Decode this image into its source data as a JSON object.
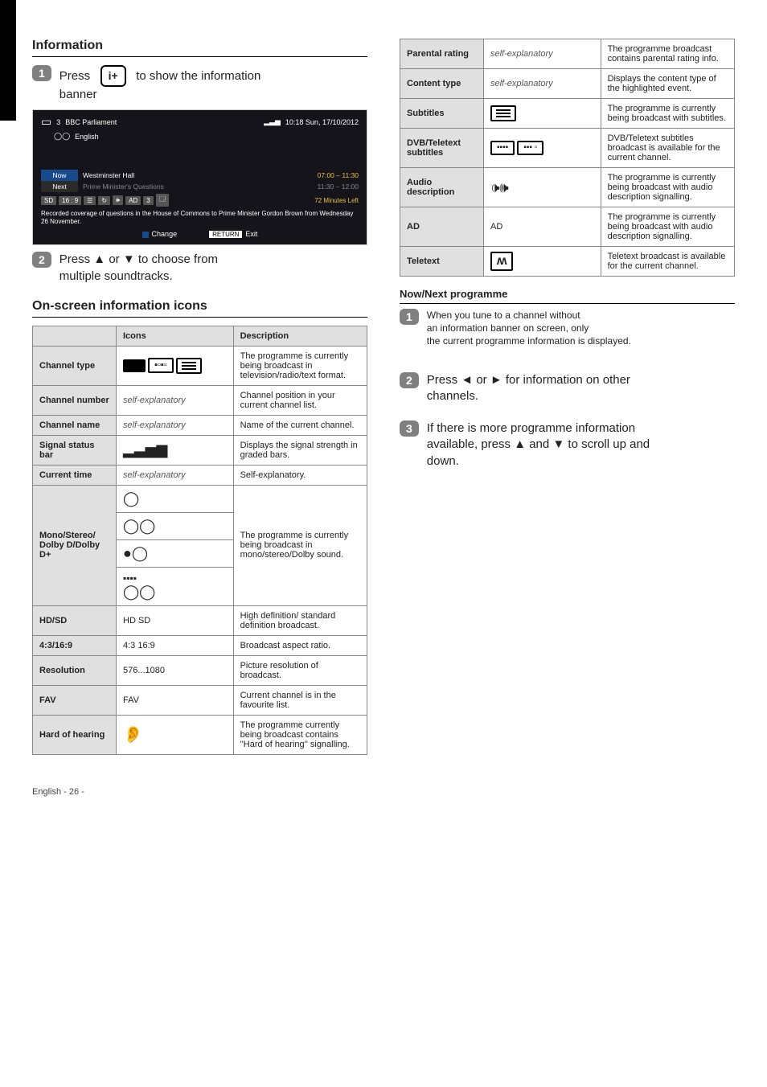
{
  "footer": "English - 26 -",
  "left": {
    "banner": {
      "chnum": "3",
      "chname": "BBC Parliament",
      "clock": "10:18  Sun, 17/10/2012",
      "lang_row_label": "English",
      "now_label": "Now",
      "now_prog": "Westminster Hall",
      "now_time": "07:00 – 11:30",
      "next_label": "Next",
      "next_prog": "Prime Minister's Questions",
      "next_time": "11:30 – 12:00",
      "chips": {
        "sd": "SD",
        "aspect": "16 : 9",
        "ad": "AD",
        "num3": "3",
        "rem": "72 Minutes Left"
      },
      "desc": "Recorded coverage of questions in the House of Commons to Prime Minister Gordon Brown from Wednesday 26 November.",
      "foot_change": "Change",
      "foot_exit": "Exit",
      "foot_return": "RETURN"
    },
    "h_info": "Information",
    "step1": "Press         to show the information",
    "step1_tail": "banner",
    "step2": "Press ▲ or ▼ to choose from",
    "step2_tail": "multiple soundtracks.",
    "h_icons": "On-screen information icons",
    "table_head": {
      "icons": "Icons",
      "desc": "Description"
    },
    "rows": [
      {
        "label": "Channel type",
        "desc": "The programme is currently being broadcast in television/radio/text format."
      },
      {
        "label": "Channel number",
        "icon_text": "self-explanatory",
        "desc": "Channel position in your current channel list."
      },
      {
        "label": "Channel name",
        "icon_text": "self-explanatory",
        "desc": "Name of the current channel."
      },
      {
        "label": "Signal status bar",
        "desc": "Displays the signal strength in graded bars."
      },
      {
        "label": "Current time",
        "icon_text": "self-explanatory",
        "desc": "Self-explanatory."
      },
      {
        "label": "Mono/Stereo/ Dolby D/Dolby D+",
        "desc": "The programme is currently being broadcast in mono/stereo/Dolby sound."
      },
      {
        "label": "HD/SD",
        "icon_text": "HD    SD",
        "desc": "High definition/ standard definition broadcast."
      },
      {
        "label": "4:3/16:9",
        "icon_text": "4:3   16:9",
        "desc": "Broadcast aspect ratio."
      },
      {
        "label": "Resolution",
        "icon_text": "576...1080",
        "desc": "Picture resolution of broadcast."
      },
      {
        "label": "FAV",
        "icon_text": "FAV",
        "desc": "Current channel is in the favourite list."
      },
      {
        "label": "Hard of hearing",
        "desc": "The programme currently being broadcast contains ''Hard of hearing'' signalling."
      }
    ]
  },
  "right": {
    "rows2": [
      {
        "label": "Parental rating",
        "icon_text": "self-explanatory",
        "desc": "The programme broadcast contains parental rating info."
      },
      {
        "label": "Content type",
        "icon_text": "self-explanatory",
        "desc": "Displays the content type of the highlighted event."
      },
      {
        "label": "Subtitles",
        "desc": "The programme is currently being broadcast with subtitles."
      },
      {
        "label": "DVB/Teletext subtitles",
        "desc": "DVB/Teletext subtitles broadcast is available for the current channel."
      },
      {
        "label": "Audio description",
        "desc": "The programme is currently being broadcast with audio description signalling."
      },
      {
        "label": "AD",
        "icon_text": "AD",
        "desc": "The programme is currently being broadcast with audio description signalling."
      },
      {
        "label": "Teletext",
        "desc": "Teletext broadcast is available for the current channel."
      }
    ],
    "sub_now": "Now/Next programme",
    "step1_text": "When you tune to a channel without",
    "step1_text2": "an information banner on screen, only",
    "step1_text3": "the current programme information is displayed.",
    "step2_text": "Press ◄ or ► for information on other",
    "step2_tail": "channels.",
    "step3_text": "If there is more programme information",
    "step3_tail": "available, press ▲ and ▼ to scroll up and",
    "step3_tail2": "down."
  }
}
